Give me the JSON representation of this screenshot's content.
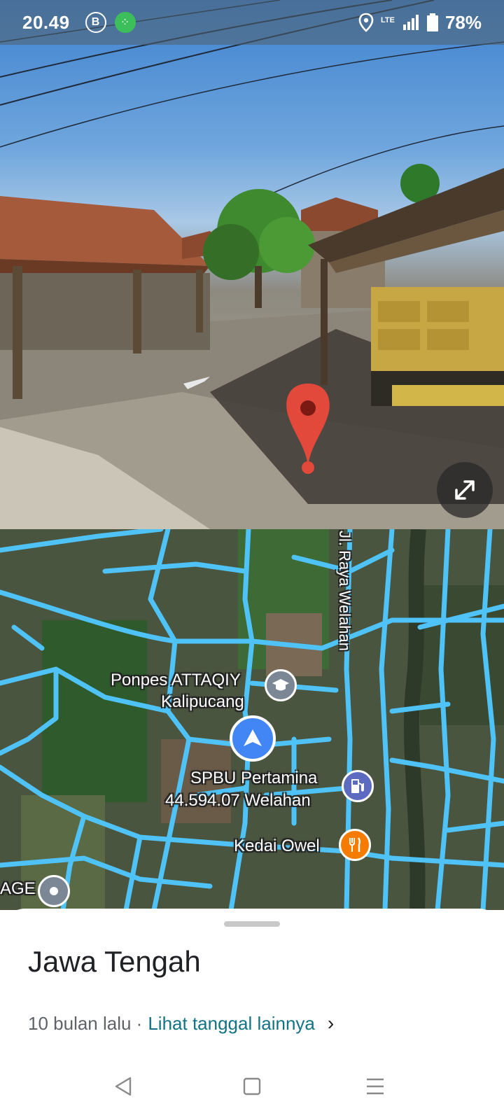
{
  "status_bar": {
    "time": "20.49",
    "b_icon": "B",
    "network": "LTE",
    "battery": "78%"
  },
  "map": {
    "road_label": "Jl. Raya Welahan",
    "poi_ponpes_line1": "Ponpes ATTAQIY",
    "poi_ponpes_line2": "Kalipucang",
    "poi_spbu_line1": "SPBU Pertamina",
    "poi_spbu_line2": "44.594.07 Welahan",
    "poi_kedai": "Kedai Owel",
    "partial_label": "AGE",
    "colors": {
      "road": "#4fc3f7",
      "location": "#4285f4",
      "restaurant": "#f57c00",
      "fuel": "#5c6bc0",
      "school": "#7b8794"
    }
  },
  "sheet": {
    "title": "Jawa Tengah",
    "time_ago": "10 bulan lalu ·",
    "link": "Lihat tanggal lainnya",
    "chevron": "›"
  }
}
